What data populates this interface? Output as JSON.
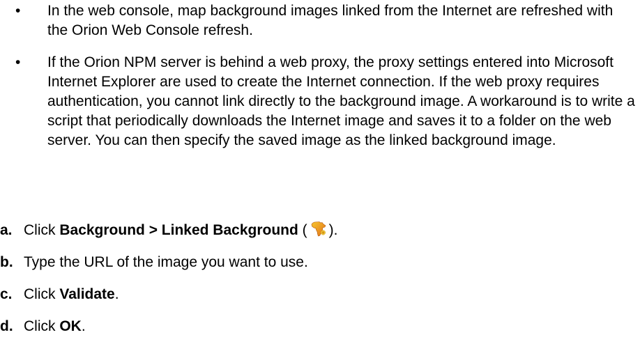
{
  "bullets": [
    "In the web console, map background images linked from the Internet are refreshed with the Orion Web Console refresh.",
    "If the Orion NPM server is behind a web proxy, the proxy settings entered into Microsoft Internet Explorer are used to create the Internet connection. If the web proxy requires authentication, you cannot link directly to the background image. A workaround is to write a script that periodically downloads the Internet image and saves it to a folder on the web server. You can then specify the saved image as the linked background image."
  ],
  "bullet_glyph": "•",
  "steps": {
    "a": {
      "marker": "a.",
      "prefix": "Click ",
      "bold": "Background > Linked Background",
      "open_paren": " (",
      "close_paren": ")."
    },
    "b": {
      "marker": "b.",
      "text": "Type the URL of the image you want to use."
    },
    "c": {
      "marker": "c.",
      "prefix": "Click ",
      "bold": "Validate",
      "suffix": "."
    },
    "d": {
      "marker": "d.",
      "prefix": "Click ",
      "bold": "OK",
      "suffix": "."
    }
  },
  "icons": {
    "linked_background": "africa-map-icon"
  },
  "colors": {
    "text": "#000000",
    "icon_orange": "#f39a1e",
    "icon_gold": "#f7c62f"
  }
}
